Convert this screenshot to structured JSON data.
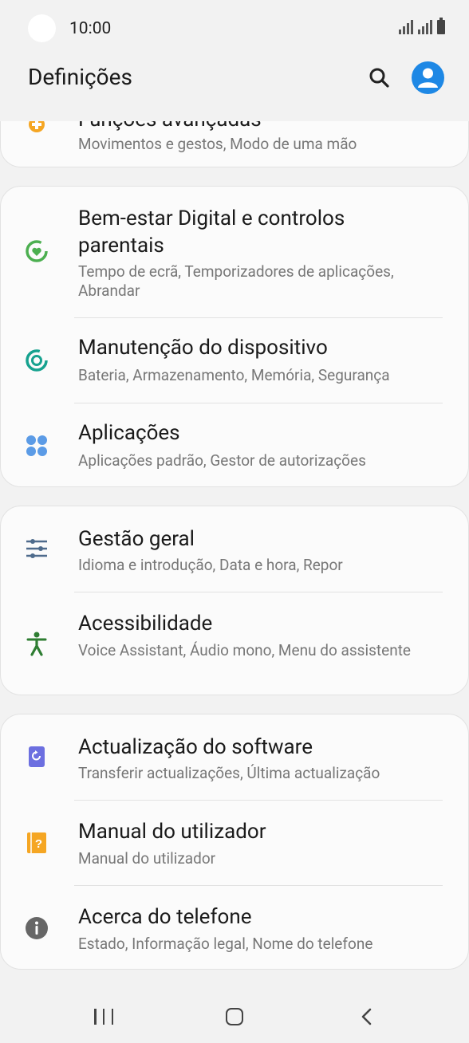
{
  "status": {
    "time": "10:00"
  },
  "header": {
    "title": "Definições"
  },
  "partial_item": {
    "title": "Funções avançadas",
    "subtitle": "Movimentos e gestos, Modo de uma mão"
  },
  "groups": [
    {
      "items": [
        {
          "title": "Bem-estar Digital e controlos parentais",
          "subtitle": "Tempo de ecrã, Temporizadores de aplicações, Abrandar",
          "icon": "digital-wellbeing-icon"
        },
        {
          "title": "Manutenção do dispositivo",
          "subtitle": "Bateria, Armazenamento, Memória, Segurança",
          "icon": "device-care-icon"
        },
        {
          "title": "Aplicações",
          "subtitle": "Aplicações padrão, Gestor de autorizações",
          "icon": "apps-icon"
        }
      ]
    },
    {
      "items": [
        {
          "title": "Gestão geral",
          "subtitle": "Idioma e introdução, Data e hora, Repor",
          "icon": "sliders-icon"
        },
        {
          "title": "Acessibilidade",
          "subtitle": "Voice Assistant, Áudio mono, Menu do assistente",
          "icon": "accessibility-icon"
        }
      ]
    },
    {
      "items": [
        {
          "title": "Actualização do software",
          "subtitle": "Transferir actualizações, Última actualização",
          "icon": "software-update-icon"
        },
        {
          "title": "Manual do utilizador",
          "subtitle": "Manual do utilizador",
          "icon": "user-manual-icon"
        },
        {
          "title": "Acerca do telefone",
          "subtitle": "Estado, Informação legal, Nome do telefone",
          "icon": "info-icon"
        }
      ]
    }
  ],
  "colors": {
    "wellbeing": "#4caf50",
    "device_care": "#16a28f",
    "apps": "#5b9be6",
    "general": "#4e6b8c",
    "accessibility": "#2e7d32",
    "update": "#6c6fe0",
    "manual": "#f5a623",
    "info": "#666666",
    "profile": "#1e88e5"
  }
}
